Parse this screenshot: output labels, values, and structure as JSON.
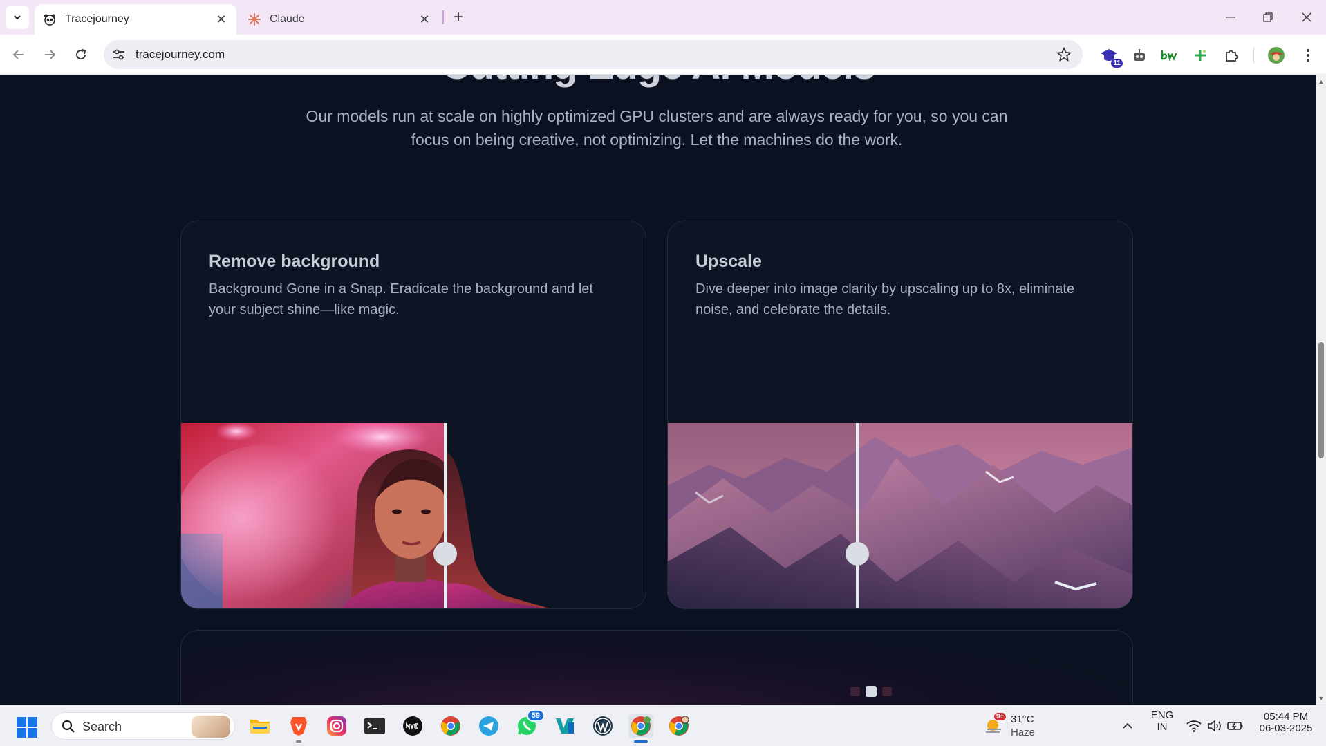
{
  "browser": {
    "tabs": [
      {
        "title": "Tracejourney",
        "active": true
      },
      {
        "title": "Claude",
        "active": false
      }
    ],
    "url": "tracejourney.com",
    "extension_badge": "11"
  },
  "page": {
    "heading_partial": "Cutting Edge AI Models",
    "subtitle": "Our models run at scale on highly optimized GPU clusters and are always ready for you, so you can focus on being creative, not optimizing. Let the machines do the work.",
    "cards": [
      {
        "title": "Remove background",
        "description": "Background Gone in a Snap. Eradicate the background and let your subject shine—like magic.",
        "slider_position": 0.56
      },
      {
        "title": "Upscale",
        "description": "Dive deeper into image clarity by upscaling up to 8x, eliminate noise, and celebrate the details.",
        "slider_position": 0.4
      }
    ],
    "carousel": {
      "count": 3,
      "active_index": 1
    }
  },
  "taskbar": {
    "search_placeholder": "Search",
    "apps": [
      "file-explorer-icon",
      "brave-icon",
      "instagram-icon",
      "terminal-icon",
      "nve-icon",
      "chrome-icon",
      "telegram-icon",
      "whatsapp-icon",
      "vs-icon",
      "wordpress-icon",
      "chrome-active-icon",
      "chrome-alt-icon"
    ],
    "whatsapp_badge": "59",
    "weather": {
      "badge": "9+",
      "temp": "31°C",
      "condition": "Haze"
    },
    "lang_top": "ENG",
    "lang_bottom": "IN",
    "time": "05:44 PM",
    "date": "06-03-2025"
  },
  "colors": {
    "page_bg": "#0b1120",
    "tab_strip": "#f2e6f7",
    "accent": "#1a6fd6"
  }
}
